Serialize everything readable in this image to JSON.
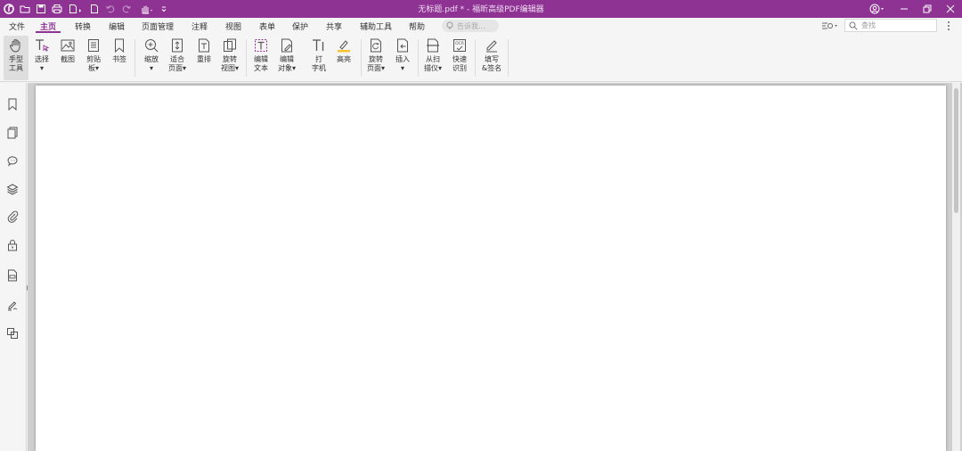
{
  "window": {
    "title": "无标题.pdf * - 福昕高级PDF编辑器",
    "accent_color": "#8e3393"
  },
  "quick_access": [
    "app-logo-icon",
    "open-folder-icon",
    "save-icon",
    "print-icon",
    "export-icon",
    "new-doc-icon",
    "undo-icon",
    "redo-icon",
    "hand-icon",
    "customize-icon"
  ],
  "menu": {
    "items": [
      "文件",
      "主页",
      "转换",
      "编辑",
      "页面管理",
      "注释",
      "视图",
      "表单",
      "保护",
      "共享",
      "辅助工具",
      "帮助"
    ],
    "active": "主页",
    "tell_me_placeholder": "告诉我...",
    "find_placeholder": "查找"
  },
  "ribbon": {
    "hand": [
      "手型",
      "工具"
    ],
    "select": [
      "选择",
      "▾"
    ],
    "screenshot": [
      "截图"
    ],
    "clipboard": [
      "剪贴",
      "板▾"
    ],
    "bookmark": [
      "书签"
    ],
    "zoom": [
      "缩放",
      "▾"
    ],
    "fit_page": [
      "适合",
      "页面▾"
    ],
    "reflow": [
      "重排"
    ],
    "rotate_view": [
      "旋转",
      "视图▾"
    ],
    "edit_text": [
      "编辑",
      "文本"
    ],
    "edit_object": [
      "编辑",
      "对象▾"
    ],
    "typewriter": [
      "打",
      "字机"
    ],
    "highlight": [
      "高亮"
    ],
    "rotate_page": [
      "旋转",
      "页面▾"
    ],
    "insert": [
      "插入",
      "▾"
    ],
    "from_scanner": [
      "从扫",
      "描仪▾"
    ],
    "quick_ocr": [
      "快速",
      "识别"
    ],
    "fill_sign": [
      "填写",
      "&签名"
    ]
  }
}
